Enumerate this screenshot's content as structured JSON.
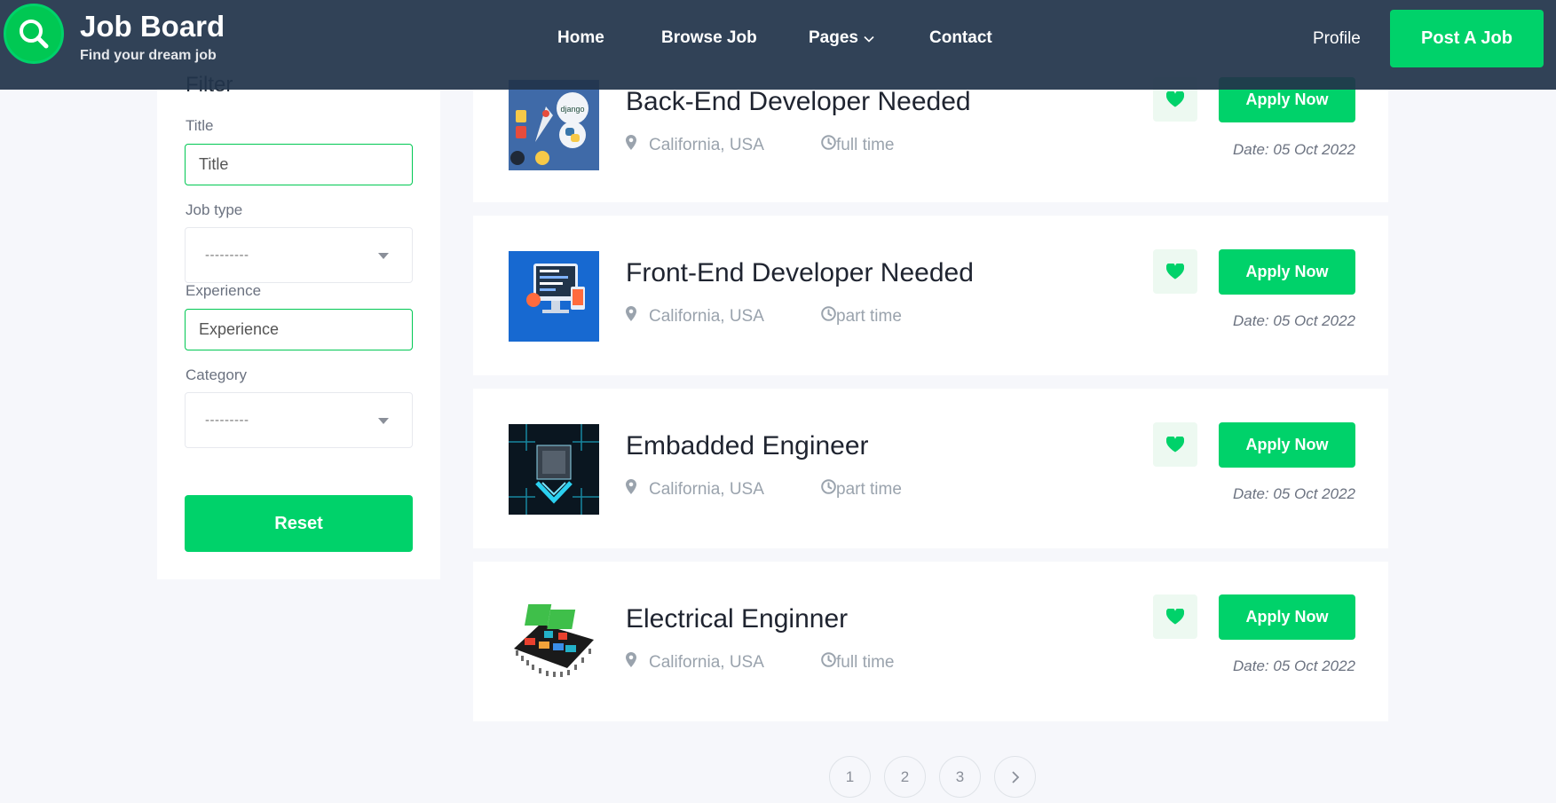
{
  "header": {
    "brand_title": "Job Board",
    "brand_tagline": "Find your dream job",
    "nav": [
      {
        "label": "Home"
      },
      {
        "label": "Browse Job"
      },
      {
        "label": "Pages"
      },
      {
        "label": "Contact"
      }
    ],
    "profile_label": "Profile",
    "post_job_label": "Post A Job"
  },
  "filter": {
    "title": "Filter",
    "title_label": "Title",
    "title_placeholder": "Title",
    "job_type_label": "Job type",
    "job_type_value": "---------",
    "experience_label": "Experience",
    "experience_placeholder": "Experience",
    "category_label": "Category",
    "category_value": "---------",
    "reset_label": "Reset"
  },
  "jobs": [
    {
      "title": "Back-End Developer Needed",
      "location": "California, USA",
      "type": "full time",
      "apply_label": "Apply Now",
      "date": "Date: 05 Oct 2022",
      "thumb": "django-python-icon"
    },
    {
      "title": "Front-End Developer Needed",
      "location": "California, USA",
      "type": "part time",
      "apply_label": "Apply Now",
      "date": "Date: 05 Oct 2022",
      "thumb": "web-development-icon"
    },
    {
      "title": "Embadded Engineer",
      "location": "California, USA",
      "type": "part time",
      "apply_label": "Apply Now",
      "date": "Date: 05 Oct 2022",
      "thumb": "chip-icon"
    },
    {
      "title": "Electrical Enginner",
      "location": "California, USA",
      "type": "full time",
      "apply_label": "Apply Now",
      "date": "Date: 05 Oct 2022",
      "thumb": "circuit-board-icon"
    }
  ],
  "pagination": {
    "pages": [
      "1",
      "2",
      "3"
    ],
    "next_icon": "chevron-right-icon"
  },
  "colors": {
    "accent": "#00d26a",
    "header_bg": "#21344a",
    "page_bg": "#f6f7fb"
  }
}
